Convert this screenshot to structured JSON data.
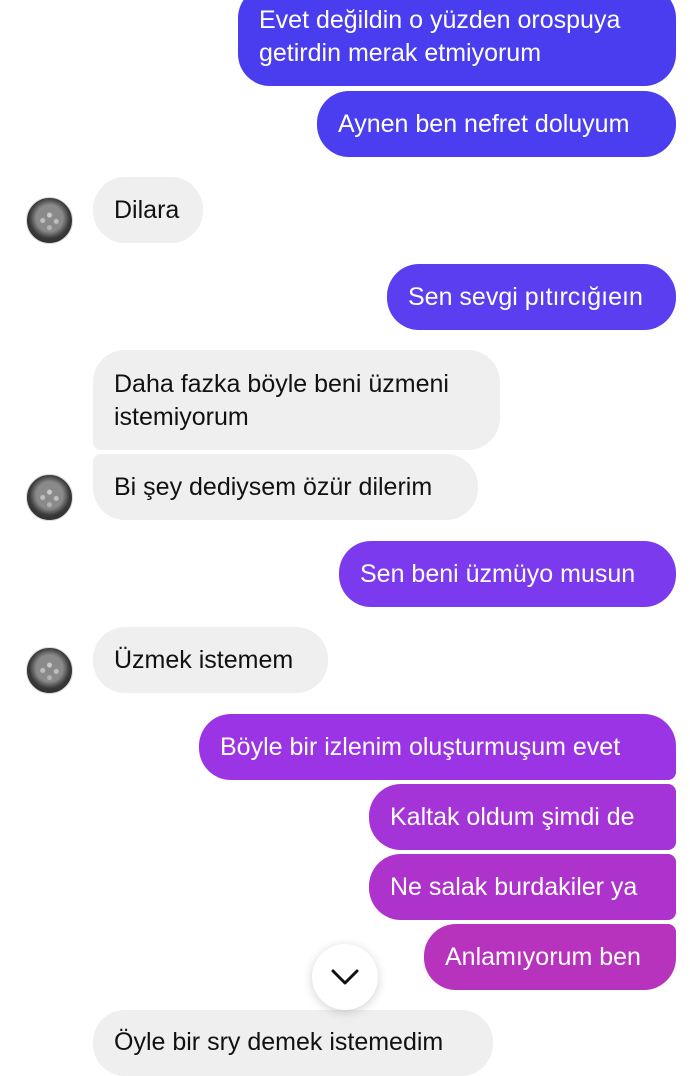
{
  "messages": [
    {
      "from": "me",
      "lines": [
        "Evet değildin o yüzden orospuya",
        "getirdin merak etmiyorum"
      ],
      "color": "#4a3df0"
    },
    {
      "from": "me",
      "text": "Aynen ben nefret doluyum",
      "color": "#4b3ef0"
    },
    {
      "from": "them",
      "text": "Dilara"
    },
    {
      "from": "me",
      "text": "Sen sevgi pıtırcığıeın",
      "color": "#5a3ef0"
    },
    {
      "from": "them",
      "lines": [
        "Daha fazka böyle beni üzmeni",
        "istemiyorum"
      ]
    },
    {
      "from": "them",
      "text": "Bi şey dediysem özür dilerim"
    },
    {
      "from": "me",
      "text": "Sen beni üzmüyo musun",
      "color": "#7c3aee"
    },
    {
      "from": "them",
      "text": "Üzmek istemem"
    },
    {
      "from": "me",
      "text": "Böyle bir izlenim oluşturmuşum evet",
      "color": "#9b34e4"
    },
    {
      "from": "me",
      "text": "Kaltak oldum şimdi de",
      "color": "#a534d8"
    },
    {
      "from": "me",
      "text": "Ne salak burdakiler ya",
      "color": "#ad33cc"
    },
    {
      "from": "me",
      "text": "Anlamıyorum ben",
      "color": "#b833bd"
    },
    {
      "from": "them",
      "text": "Öyle bir sry demek istemedim"
    }
  ],
  "avatar_icon": "contact-avatar",
  "scroll_button_icon": "chevron-down-icon"
}
